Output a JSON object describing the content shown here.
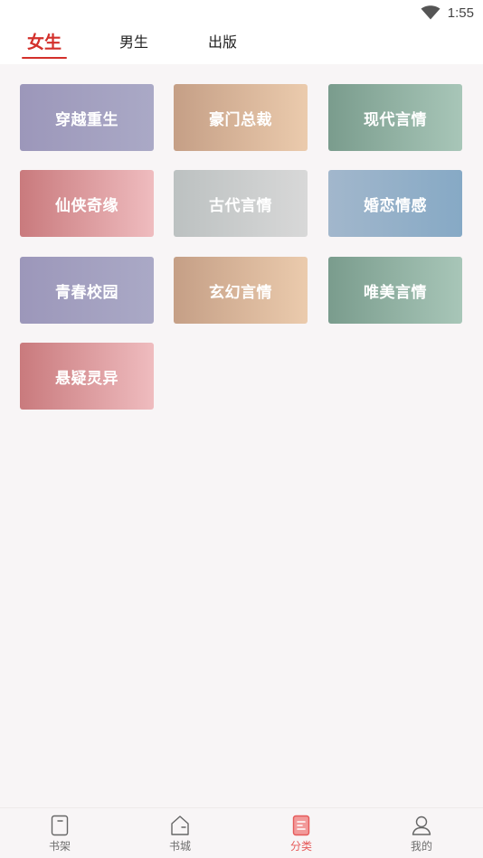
{
  "status_bar": {
    "time": "1:55",
    "wifi_icon": "wifi-icon"
  },
  "tabs": [
    {
      "label": "女生",
      "active": true
    },
    {
      "label": "男生",
      "active": false
    },
    {
      "label": "出版",
      "active": false
    }
  ],
  "colors": {
    "accent": "#d3302b",
    "nav_active": "#e65a5a",
    "background": "#f8f5f6"
  },
  "categories": [
    {
      "label": "穿越重生"
    },
    {
      "label": "豪门总裁"
    },
    {
      "label": "现代言情"
    },
    {
      "label": "仙侠奇缘"
    },
    {
      "label": "古代言情"
    },
    {
      "label": "婚恋情感"
    },
    {
      "label": "青春校园"
    },
    {
      "label": "玄幻言情"
    },
    {
      "label": "唯美言情"
    },
    {
      "label": "悬疑灵异"
    }
  ],
  "bottom_nav": [
    {
      "label": "书架",
      "icon": "bookshelf-icon",
      "active": false
    },
    {
      "label": "书城",
      "icon": "bookstore-icon",
      "active": false
    },
    {
      "label": "分类",
      "icon": "category-icon",
      "active": true
    },
    {
      "label": "我的",
      "icon": "profile-icon",
      "active": false
    }
  ]
}
